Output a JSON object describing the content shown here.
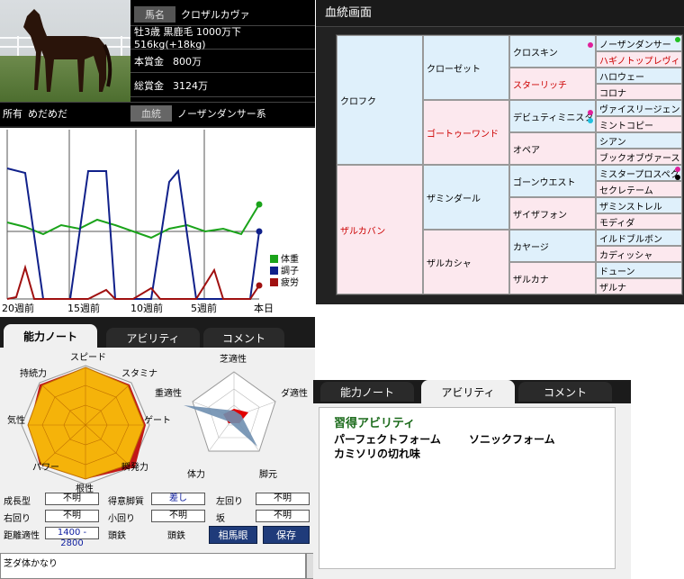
{
  "horse": {
    "name_label": "馬名",
    "name": "クロザルカヴァ",
    "profile": "牡3歳 黒鹿毛 1000万下 516kg(+18kg)",
    "prize_label": "本賞金",
    "prize": "800万",
    "total_prize_label": "総賞金",
    "total_prize": "3124万",
    "owner_label": "所有",
    "owner": "めだめだ",
    "lineage_label": "血統",
    "lineage": "ノーザンダンサー系"
  },
  "chart": {
    "xticks": [
      "20週前",
      "15週前",
      "10週前",
      "5週前",
      "本日"
    ],
    "legend": [
      {
        "name": "体重",
        "color": "#1aa31a"
      },
      {
        "name": "調子",
        "color": "#10208a"
      },
      {
        "name": "疲労",
        "color": "#a01010"
      }
    ]
  },
  "pedigree": {
    "title": "血統画面",
    "sire": "クロフク",
    "dam": "ザルカバン",
    "g2": [
      "クローゼット",
      "ゴートゥーワンド",
      "ザミンダール",
      "ザルカシャ"
    ],
    "g3": [
      "クロスキン",
      "スターリッチ",
      "デビュティミニスタ",
      "オペア",
      "ゴーンウエスト",
      "ザイザフォン",
      "カヤージ",
      "ザルカナ"
    ],
    "g4": [
      "ノーザンダンサー",
      "ハギノトップレヴィ",
      "ハロウェー",
      "コロナ",
      "ヴァイスリージェン",
      "ミントコピー",
      "シアン",
      "ブックオブヴァース",
      "ミスタープロスペク",
      "セクレテーム",
      "ザミンストレル",
      "モディダ",
      "イルドブルボン",
      "カディッシャ",
      "ドューン",
      "ザルナ"
    ]
  },
  "note": {
    "tabs": [
      "能力ノート",
      "アビリティ",
      "コメント"
    ],
    "radar1_labels": [
      "スピード",
      "スタミナ",
      "ゲート",
      "瞬発力",
      "根性",
      "パワー",
      "気性",
      "持続力"
    ],
    "radar2_labels": [
      "芝適性",
      "ダ適性",
      "脚元",
      "体力",
      "重適性"
    ],
    "fields": [
      {
        "label": "成長型",
        "value": "不明"
      },
      {
        "label": "得意脚質",
        "value": "差し"
      },
      {
        "label": "左回り",
        "value": "不明"
      },
      {
        "label": "右回り",
        "value": "不明"
      },
      {
        "label": "小回り",
        "value": "不明"
      },
      {
        "label": "坂",
        "value": "不明"
      }
    ],
    "distance_label": "距離適性",
    "distance_value": "1400 - 2800",
    "iron_label1": "頭鉄",
    "iron_label2": "頭鉄",
    "btn_souma": "相馬眼",
    "btn_save": "保存",
    "comment": "芝ダ体かなり"
  },
  "abilities": {
    "tabs": [
      "能力ノート",
      "アビリティ",
      "コメント"
    ],
    "heading": "習得アビリティ",
    "items": [
      "パーフェクトフォーム",
      "ソニックフォーム",
      "カミソリの切れ味"
    ]
  }
}
